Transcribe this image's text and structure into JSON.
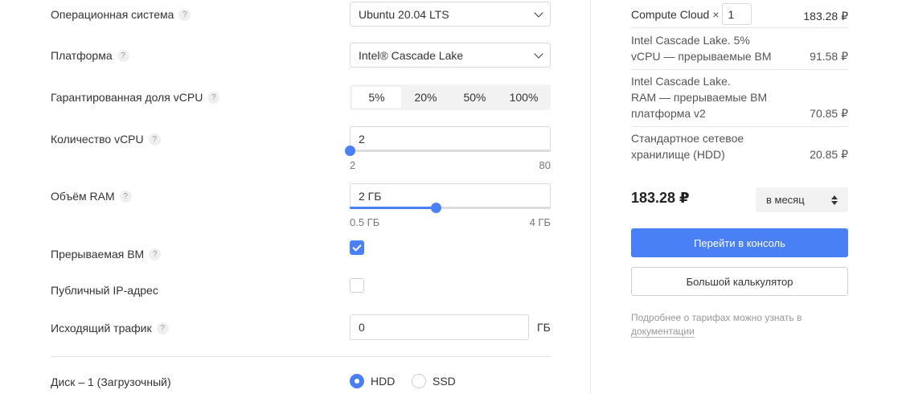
{
  "form": {
    "os": {
      "label": "Операционная система",
      "value": "Ubuntu 20.04 LTS"
    },
    "platform": {
      "label": "Платформа",
      "value": "Intel® Cascade Lake"
    },
    "vcpu_share": {
      "label": "Гарантированная доля vCPU",
      "options": [
        "5%",
        "20%",
        "50%",
        "100%"
      ],
      "selected": "5%"
    },
    "vcpu_count": {
      "label": "Количество vCPU",
      "value": "2",
      "min": "2",
      "max": "80",
      "level": 0
    },
    "ram": {
      "label": "Объём RAM",
      "value": "2 ГБ",
      "min": "0.5 ГБ",
      "max": "4 ГБ",
      "level": 0.43
    },
    "preemptible": {
      "label": "Прерываемая ВМ",
      "checked": true
    },
    "public_ip": {
      "label": "Публичный IP-адрес",
      "checked": false
    },
    "traffic": {
      "label": "Исходящий трафик",
      "value": "0",
      "unit": "ГБ"
    },
    "disk": {
      "label": "Диск – 1 (Загрузочный)",
      "options": [
        "HDD",
        "SSD"
      ],
      "selected": "HDD"
    },
    "help_glyph": "?"
  },
  "summary": {
    "service": {
      "name": "Compute Cloud",
      "multiplier": "×",
      "quantity": "1",
      "price": "183.28 ₽"
    },
    "items": [
      {
        "line1": "Intel Cascade Lake. 5%",
        "line2": "vCPU — прерываемые ВМ",
        "line3": "",
        "price": "91.58 ₽"
      },
      {
        "line1": "Intel Cascade Lake.",
        "line2": "RAM — прерываемые ВМ",
        "line3": "платформа v2",
        "price": "70.85 ₽"
      },
      {
        "line1": "Стандартное сетевое",
        "line2": "хранилище (HDD)",
        "line3": "",
        "price": "20.85 ₽"
      }
    ],
    "total": "183.28 ₽",
    "period": "в месяц",
    "console_button": "Перейти в консоль",
    "calculator_button": "Большой калькулятор",
    "note_text": "Подробнее о тарифах можно узнать в",
    "note_link": "документации"
  },
  "colors": {
    "accent": "#4a80f5"
  }
}
